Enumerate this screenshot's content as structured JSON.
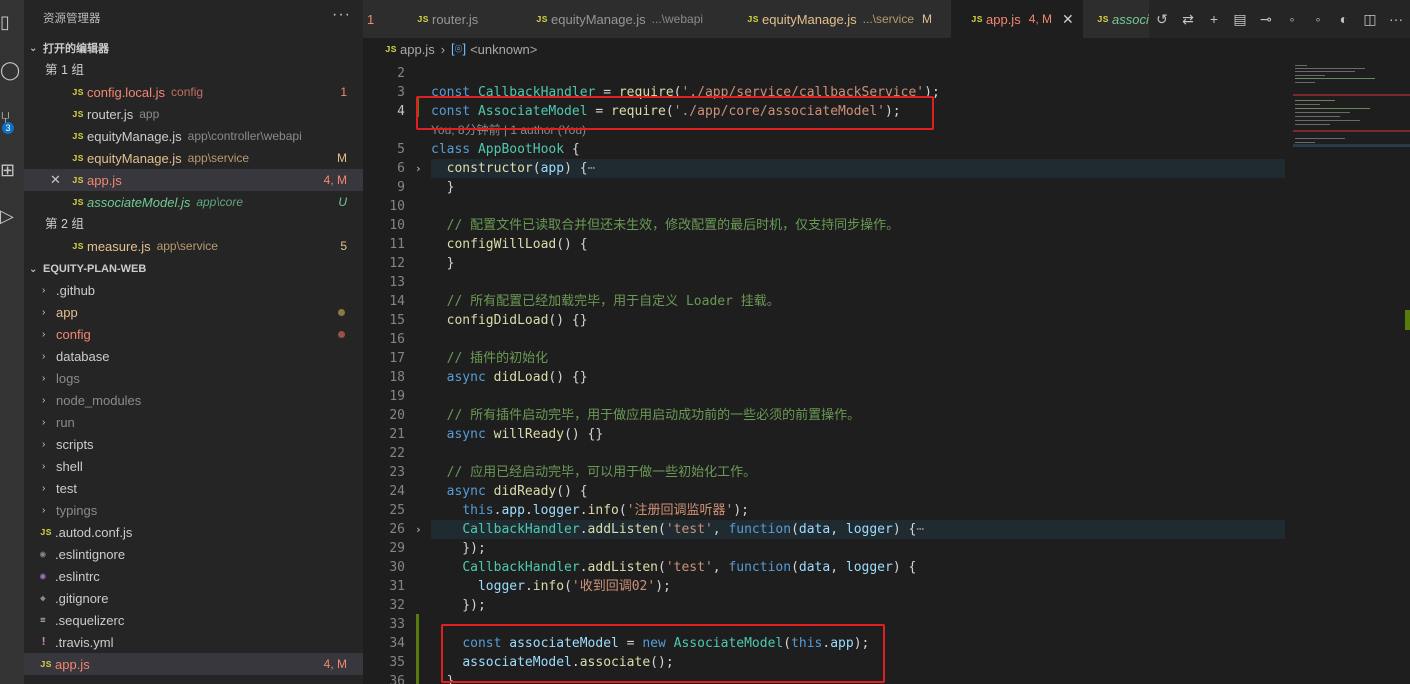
{
  "activity_bar": {
    "badge": "3"
  },
  "sidebar": {
    "title": "资源管理器",
    "more": "···",
    "open_editors": {
      "header": "打开的编辑器",
      "group1": "第 1 组",
      "group2": "第 2 组",
      "items": [
        {
          "name": "config.local.js",
          "desc": "config",
          "badge": "1",
          "badge_type": "err"
        },
        {
          "name": "router.js",
          "desc": "app",
          "badge": "",
          "badge_type": ""
        },
        {
          "name": "equityManage.js",
          "desc": "app\\controller\\webapi",
          "badge": "",
          "badge_type": ""
        },
        {
          "name": "equityManage.js",
          "desc": "app\\service",
          "badge": "M",
          "badge_type": "mod"
        },
        {
          "name": "app.js",
          "desc": "",
          "badge": "4, M",
          "badge_type": "err"
        },
        {
          "name": "associateModel.js",
          "desc": "app\\core",
          "badge": "U",
          "badge_type": "untr"
        },
        {
          "name": "measure.js",
          "desc": "app\\service",
          "badge": "5",
          "badge_type": "mod"
        }
      ]
    },
    "project": {
      "header": "EQUITY-PLAN-WEB",
      "folders": [
        ".github",
        "app",
        "config",
        "database",
        "logs",
        "node_modules",
        "run",
        "scripts",
        "shell",
        "test",
        "typings"
      ],
      "files": [
        ".autod.conf.js",
        ".eslintignore",
        ".eslintrc",
        ".gitignore",
        ".sequelizerc",
        ".travis.yml",
        "app.js"
      ],
      "app_js_badge": "4, M"
    }
  },
  "tabs": [
    {
      "name": "1",
      "desc": "",
      "badge": ""
    },
    {
      "name": "router.js",
      "desc": "",
      "badge": ""
    },
    {
      "name": "equityManage.js",
      "desc": "...\\webapi",
      "badge": ""
    },
    {
      "name": "equityManage.js",
      "desc": "...\\service",
      "badge": "M"
    },
    {
      "name": "app.js",
      "desc": "",
      "badge": "4, M"
    },
    {
      "name": "associ",
      "desc": "",
      "badge": ""
    }
  ],
  "breadcrumb": {
    "file": "app.js",
    "symbol": "<unknown>"
  },
  "code": {
    "blame": "You, 8分钟前 | 1 author (You)",
    "comment_10": "// 配置文件已读取合并但还未生效，修改配置的最后时机，仅支持同步操作。",
    "comment_14": "// 所有配置已经加载完毕，用于自定义 Loader 挂载。",
    "comment_17": "// 插件的初始化",
    "comment_20": "// 所有插件启动完毕，用于做应用启动成功前的一些必须的前置操作。",
    "comment_23": "// 应用已经启动完毕，可以用于做一些初始化工作。",
    "str_25": "'注册回调监听器'",
    "str_31": "'收到回调02'"
  }
}
